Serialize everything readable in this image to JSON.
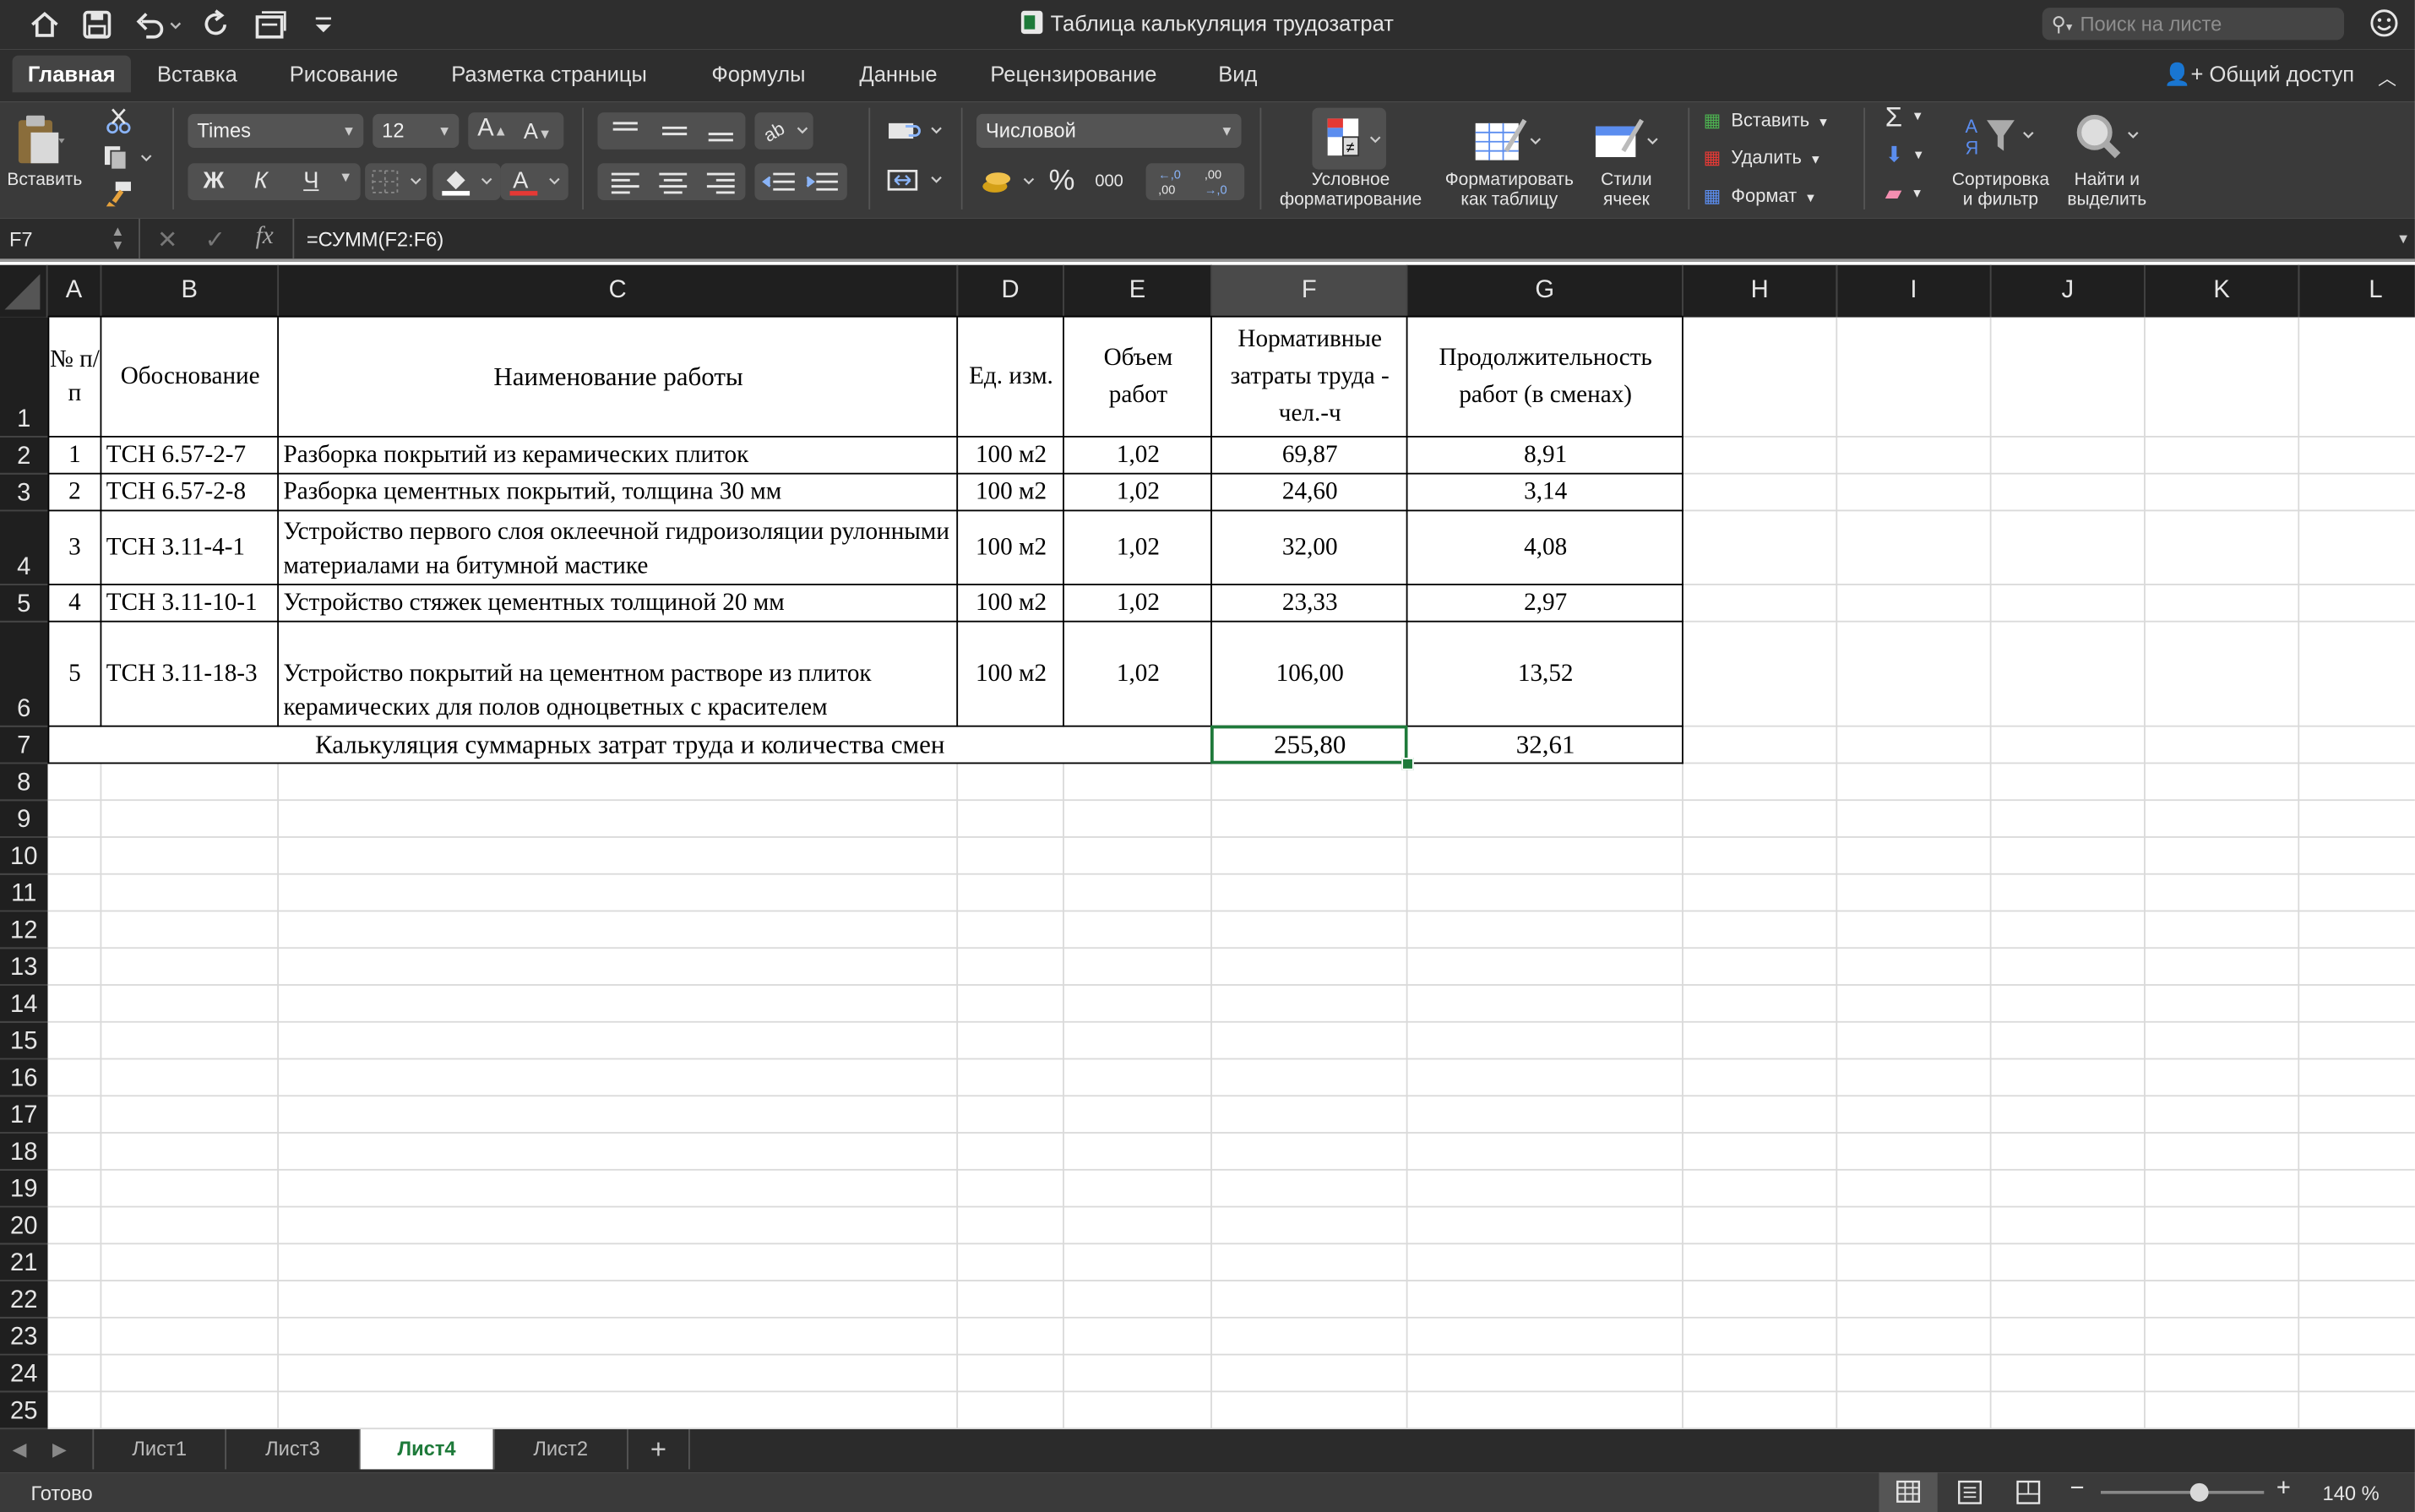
{
  "window": {
    "title": "Таблица калькуляция трудозатрат",
    "search_placeholder": "Поиск на листе"
  },
  "ribbon_tabs": [
    "Главная",
    "Вставка",
    "Рисование",
    "Разметка страницы",
    "Формулы",
    "Данные",
    "Рецензирование",
    "Вид"
  ],
  "share_label": "Общий доступ",
  "ribbon": {
    "paste_label": "Вставить",
    "font_name": "Times",
    "font_size": "12",
    "bold": "Ж",
    "italic": "К",
    "underline": "Ч",
    "number_format": "Числовой",
    "percent": "%",
    "thousands": "000",
    "cond_format_l1": "Условное",
    "cond_format_l2": "форматирование",
    "format_table_l1": "Форматировать",
    "format_table_l2": "как таблицу",
    "styles_l1": "Стили",
    "styles_l2": "ячеек",
    "insert_label": "Вставить",
    "delete_label": "Удалить",
    "format_label": "Формат",
    "sort_l1": "Сортировка",
    "sort_l2": "и фильтр",
    "find_l1": "Найти и",
    "find_l2": "выделить"
  },
  "formula_bar": {
    "cell_ref": "F7",
    "fx": "fx",
    "formula": "=СУММ(F2:F6)"
  },
  "columns": [
    "A",
    "B",
    "C",
    "D",
    "E",
    "F",
    "G",
    "H",
    "I",
    "J",
    "K",
    "L"
  ],
  "rows": [
    "1",
    "2",
    "3",
    "4",
    "5",
    "6",
    "7",
    "8",
    "9",
    "10",
    "11",
    "12",
    "13",
    "14",
    "15",
    "16",
    "17",
    "18",
    "19",
    "20",
    "21",
    "22",
    "23",
    "24",
    "25"
  ],
  "table": {
    "headers": {
      "num": "№ п/п",
      "basis": "Обоснование",
      "name": "Наименование работы",
      "unit": "Ед. изм.",
      "volume": "Объем работ",
      "labor": "Нормативные затраты труда - чел.-ч",
      "duration": "Продолжительность работ (в сменах)"
    },
    "items": [
      {
        "num": "1",
        "basis": "ТСН 6.57-2-7",
        "name": "Разборка покрытий из керамических плиток",
        "unit": "100 м2",
        "volume": "1,02",
        "labor": "69,87",
        "duration": "8,91"
      },
      {
        "num": "2",
        "basis": "ТСН 6.57-2-8",
        "name": "Разборка цементных покрытий, толщина 30 мм",
        "unit": "100 м2",
        "volume": "1,02",
        "labor": "24,60",
        "duration": "3,14"
      },
      {
        "num": "3",
        "basis": "ТСН 3.11-4-1",
        "name": "Устройство первого слоя оклеечной гидроизоляции рулонными материалами на битумной мастике",
        "unit": "100 м2",
        "volume": "1,02",
        "labor": "32,00",
        "duration": "4,08"
      },
      {
        "num": "4",
        "basis": "ТСН 3.11-10-1",
        "name": "Устройство стяжек цементных толщиной 20 мм",
        "unit": "100 м2",
        "volume": "1,02",
        "labor": "23,33",
        "duration": "2,97"
      },
      {
        "num": "5",
        "basis": "ТСН 3.11-18-3",
        "name": "Устройство покрытий на цементном растворе из плиток керамических для полов одноцветных с красителем",
        "unit": "100 м2",
        "volume": "1,02",
        "labor": "106,00",
        "duration": "13,52"
      }
    ],
    "total_label": "Калькуляция суммарных затрат труда и количества смен",
    "total_labor": "255,80",
    "total_duration": "32,61"
  },
  "sheets": [
    "Лист1",
    "Лист3",
    "Лист4",
    "Лист2"
  ],
  "active_sheet": "Лист4",
  "status": {
    "ready": "Готово",
    "zoom": "140 %",
    "zoom_level": 0.6
  },
  "colors": {
    "accent_green": "#1e7a3a",
    "selection": "#1e7a3a"
  }
}
